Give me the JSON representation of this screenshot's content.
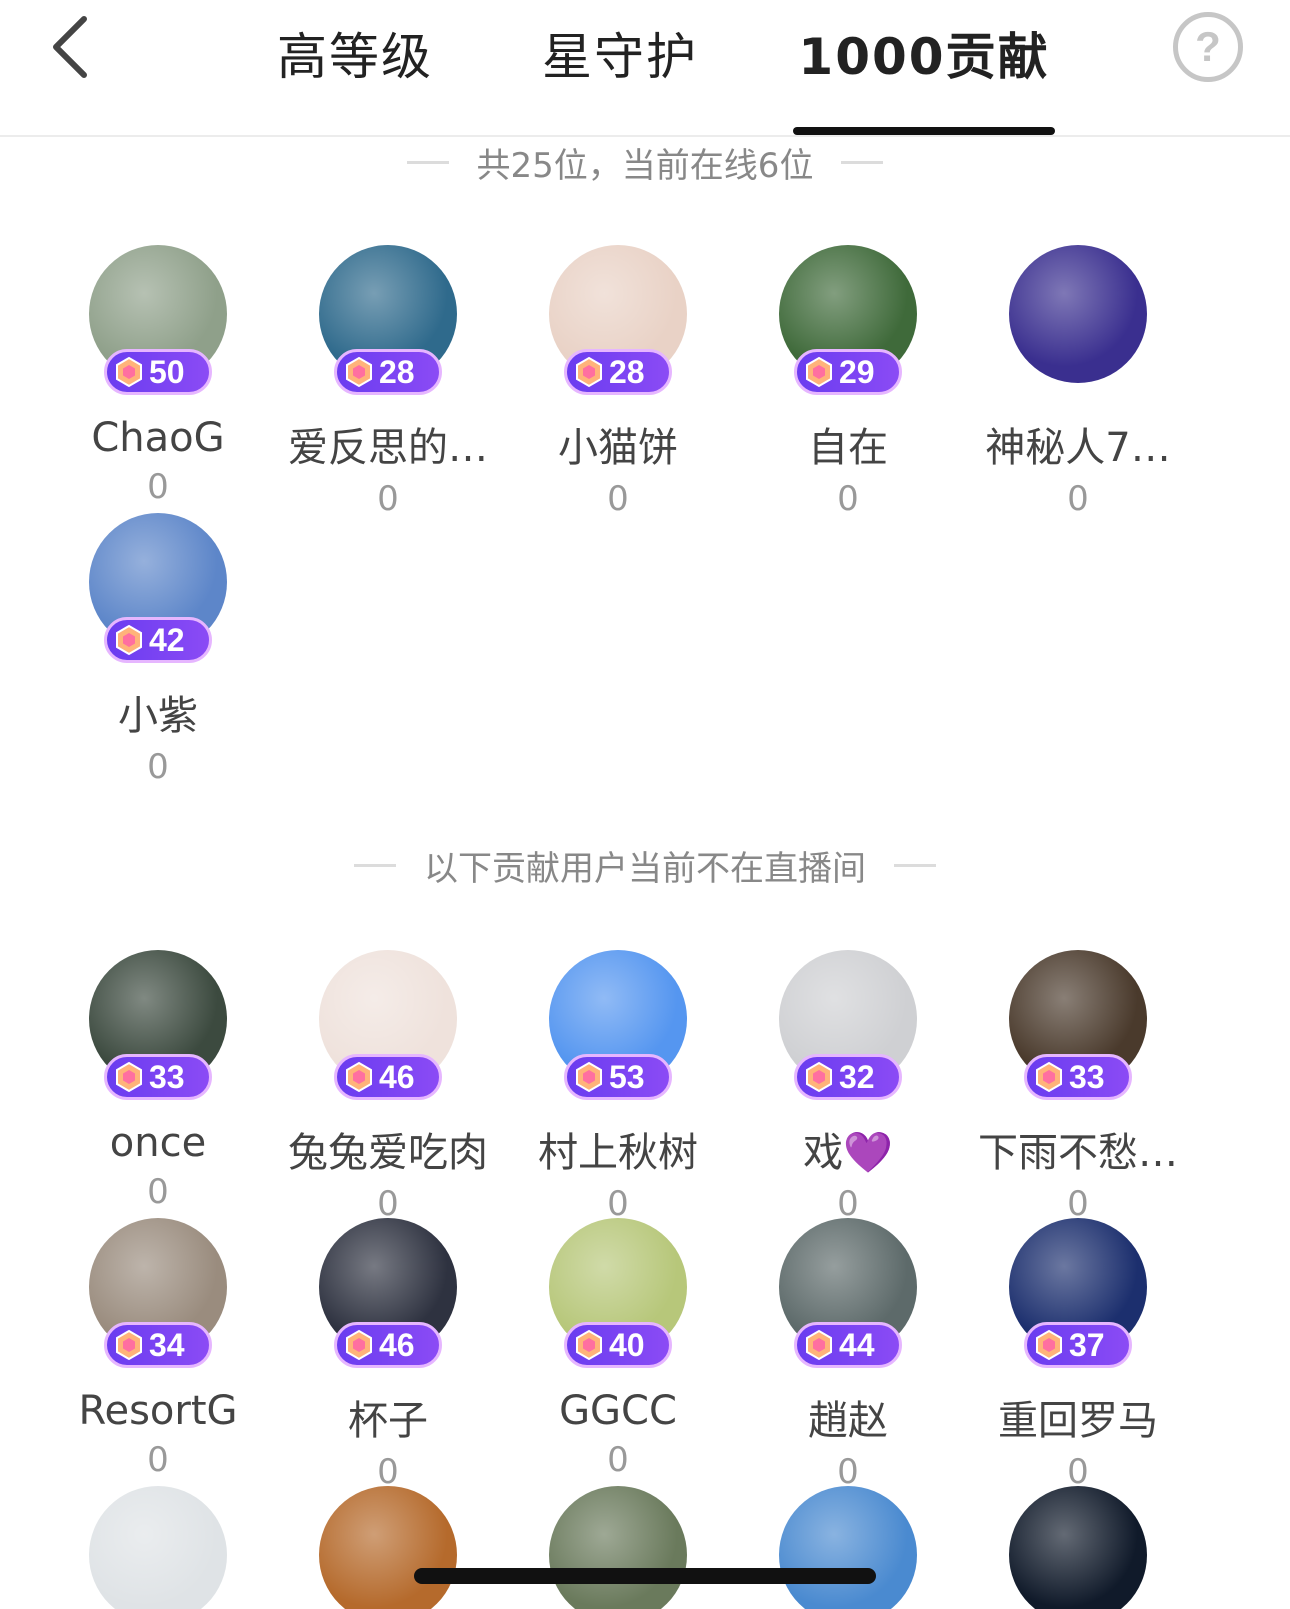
{
  "header": {
    "tabs": [
      {
        "label": "高等级",
        "active": false
      },
      {
        "label": "星守护",
        "active": false
      },
      {
        "label": "1000贡献",
        "active": true
      }
    ],
    "help_label": "?",
    "back_icon": "chevron-left-icon"
  },
  "online": {
    "summary": "共25位，当前在线6位",
    "users": [
      {
        "name": "ChaoG",
        "level": "50",
        "score": "0",
        "avatar_color": "#8fa08a"
      },
      {
        "name": "爱反思的…",
        "level": "28",
        "score": "0",
        "avatar_color": "#2f6a8c"
      },
      {
        "name": "小猫饼",
        "level": "28",
        "score": "0",
        "avatar_color": "#e9d2c6"
      },
      {
        "name": "自在",
        "level": "29",
        "score": "0",
        "avatar_color": "#3f6a3a"
      },
      {
        "name": "神秘人7…",
        "level": "",
        "score": "0",
        "avatar_color": "#3a2f8f"
      },
      {
        "name": "小紫",
        "level": "42",
        "score": "0",
        "avatar_color": "#5d86c9"
      }
    ]
  },
  "offline": {
    "summary": "以下贡献用户当前不在直播间",
    "users": [
      {
        "name": "once",
        "level": "33",
        "score": "0",
        "avatar_color": "#3c4a3f"
      },
      {
        "name": "兔兔爱吃肉",
        "level": "46",
        "score": "0",
        "avatar_color": "#efe2dc"
      },
      {
        "name": "村上秋树",
        "level": "53",
        "score": "0",
        "avatar_color": "#5596f0"
      },
      {
        "name": "戏💜",
        "level": "32",
        "score": "0",
        "avatar_color": "#cfd0d3"
      },
      {
        "name": "下雨不愁…",
        "level": "33",
        "score": "0",
        "avatar_color": "#4a3a2c"
      },
      {
        "name": "ResortG",
        "level": "34",
        "score": "0",
        "avatar_color": "#9a8c7e"
      },
      {
        "name": "杯子",
        "level": "46",
        "score": "0",
        "avatar_color": "#2e3240"
      },
      {
        "name": "GGCC",
        "level": "40",
        "score": "0",
        "avatar_color": "#b7c77a"
      },
      {
        "name": "趙赵",
        "level": "44",
        "score": "0",
        "avatar_color": "#5d6a6a"
      },
      {
        "name": "重回罗马",
        "level": "37",
        "score": "0",
        "avatar_color": "#1c2f6e"
      },
      {
        "name": "",
        "level": "",
        "score": "",
        "avatar_color": "#dfe3e6"
      },
      {
        "name": "",
        "level": "",
        "score": "",
        "avatar_color": "#b56a2c"
      },
      {
        "name": "",
        "level": "",
        "score": "",
        "avatar_color": "#6a7a5c"
      },
      {
        "name": "",
        "level": "",
        "score": "",
        "avatar_color": "#4a8ad0"
      },
      {
        "name": "",
        "level": "",
        "score": "",
        "avatar_color": "#101a2a"
      }
    ]
  }
}
